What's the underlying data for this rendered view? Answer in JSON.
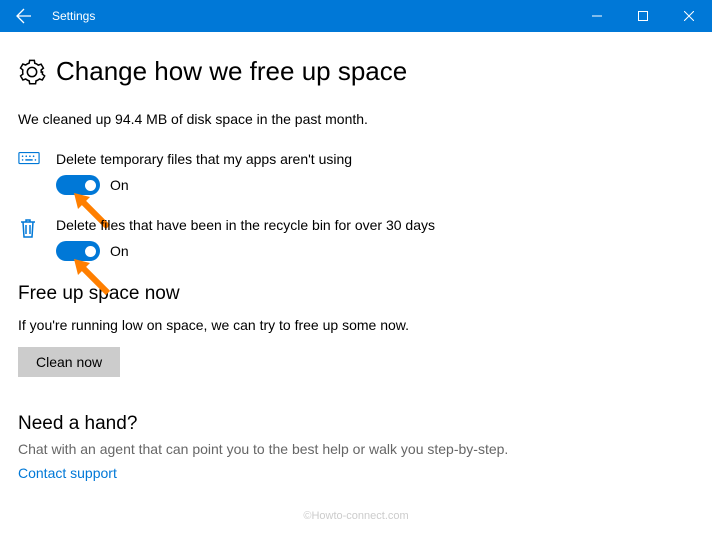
{
  "window": {
    "title": "Settings"
  },
  "page": {
    "title": "Change how we free up space",
    "status": "We cleaned up 94.4 MB of disk space in the past month."
  },
  "settings": {
    "tempFiles": {
      "label": "Delete temporary files that my apps aren't using",
      "state": "On"
    },
    "recycle": {
      "label": "Delete files that have been in the recycle bin for over 30 days",
      "state": "On"
    }
  },
  "freeUp": {
    "heading": "Free up space now",
    "text": "If you're running low on space, we can try to free up some now.",
    "button": "Clean now"
  },
  "help": {
    "heading": "Need a hand?",
    "text": "Chat with an agent that can point you to the best help or walk you step-by-step.",
    "link": "Contact support"
  },
  "watermark": "©Howto-connect.com",
  "colors": {
    "accent": "#0078d7"
  }
}
